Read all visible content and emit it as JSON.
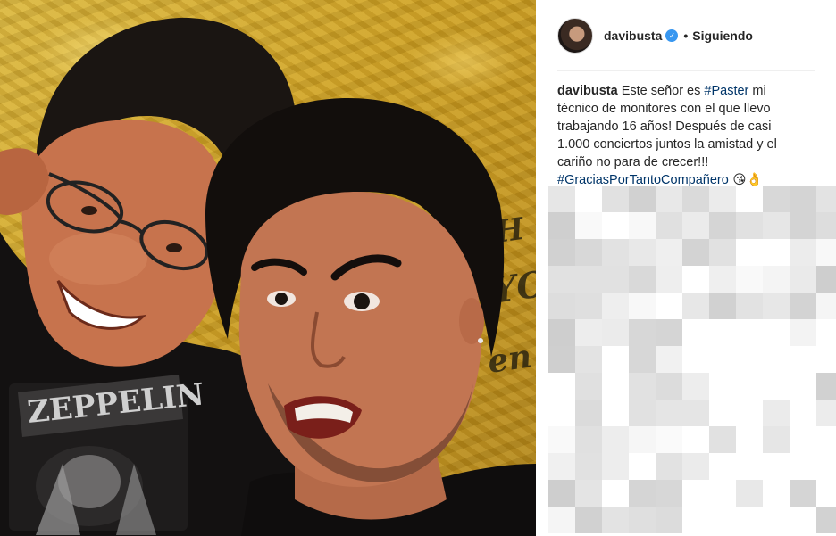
{
  "post": {
    "author": "davibusta",
    "verified_icon": "verified-badge-icon",
    "separator": "•",
    "follow_status": "Siguiendo",
    "caption": {
      "username": "davibusta",
      "text_1": " Este señor es ",
      "hashtag_1": "#Paster",
      "text_2": " mi técnico de monitores con el que llevo trabajando 16 años! Después de casi 1.000 conciertos juntos la amistad y el cariño no para de crecer!!! ",
      "hashtag_2": "#GraciasPorTantoCompañero",
      "emojis": " 😘👌"
    },
    "shirt_text": "ZEPPELIN"
  },
  "colors": {
    "link": "#003569",
    "verified": "#3897f0",
    "divider": "#efefef"
  }
}
